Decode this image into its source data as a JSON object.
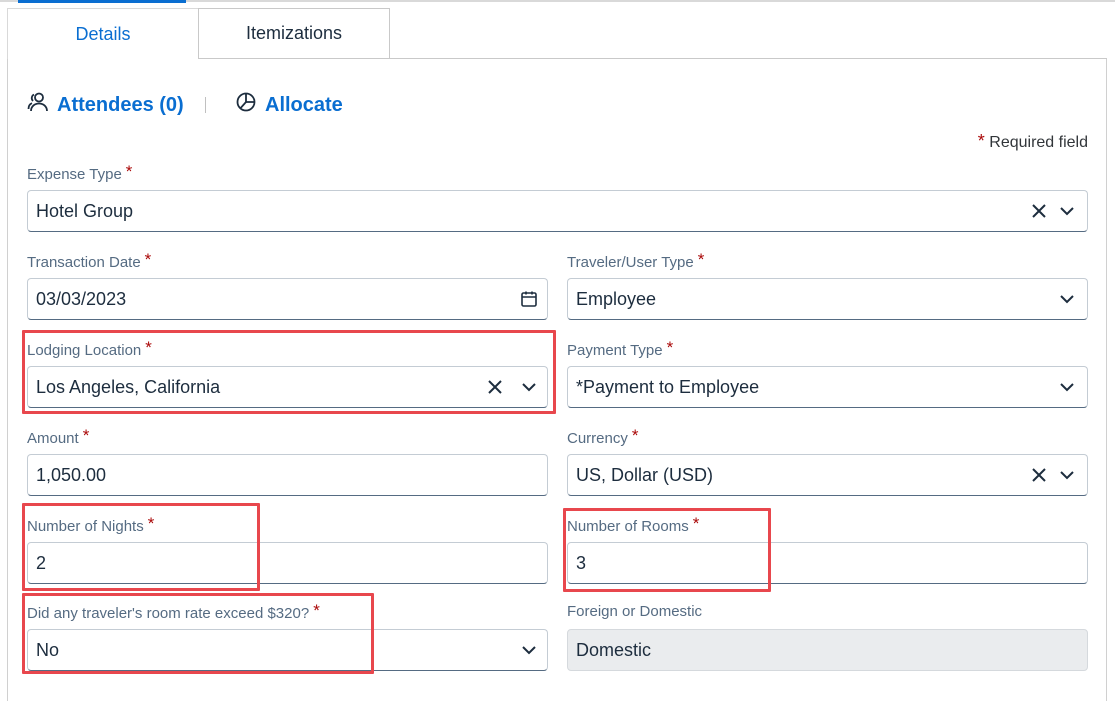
{
  "tabs": {
    "details": "Details",
    "itemizations": "Itemizations"
  },
  "actions": {
    "attendees": "Attendees (0)",
    "allocate": "Allocate"
  },
  "required_note": {
    "star": "*",
    "text": "Required field"
  },
  "fields": {
    "expense_type": {
      "label": "Expense Type",
      "value": "Hotel Group"
    },
    "transaction_date": {
      "label": "Transaction Date",
      "value": "03/03/2023"
    },
    "traveler_type": {
      "label": "Traveler/User Type",
      "value": "Employee"
    },
    "lodging_location": {
      "label": "Lodging Location",
      "value": "Los Angeles, California"
    },
    "payment_type": {
      "label": "Payment Type",
      "value": "*Payment to Employee"
    },
    "amount": {
      "label": "Amount",
      "value": "1,050.00"
    },
    "currency": {
      "label": "Currency",
      "value": "US, Dollar (USD)"
    },
    "nights": {
      "label": "Number of Nights",
      "value": "2"
    },
    "rooms": {
      "label": "Number of Rooms",
      "value": "3"
    },
    "rate_exceed": {
      "label": "Did any traveler's room rate exceed $320?",
      "value": "No"
    },
    "foreign_domestic": {
      "label": "Foreign or Domestic",
      "value": "Domestic"
    }
  },
  "star": "*",
  "colors": {
    "accent": "#0a6ed1",
    "required": "#aa0808",
    "highlight": "#e8474d"
  }
}
